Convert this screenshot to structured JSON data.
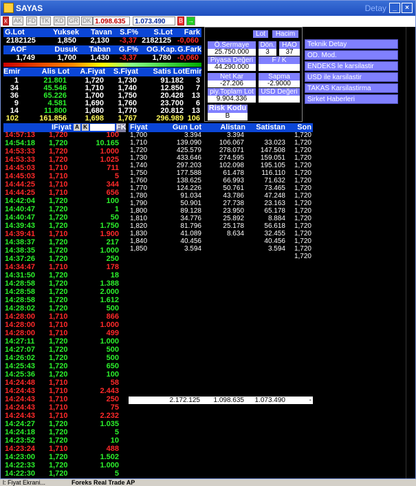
{
  "window": {
    "title": "SAYAS",
    "detay": "Detay"
  },
  "toolbar": {
    "tabs": [
      "AK",
      "FD",
      "TK",
      "KD",
      "GR",
      "DK"
    ],
    "field1": "1.098.635",
    "field2": "1.073.490",
    "b_label": "B"
  },
  "summary": {
    "h1": [
      "G.Lot",
      "Yuksek",
      "Tavan",
      "S.F%",
      "S.Lot",
      "Fark"
    ],
    "v1": [
      "2182125",
      "1,850",
      "2,130",
      "-3,37",
      "2182125",
      "-0,060"
    ],
    "h2": [
      "AOF",
      "Dusuk",
      "Taban",
      "G.F%",
      "OG.Kap.",
      "G.Fark"
    ],
    "v2": [
      "1,749",
      "1,700",
      "1,430",
      "-3,37",
      "1,780",
      "-0,060"
    ]
  },
  "book": {
    "headers": [
      "Emir",
      "Alis Lot",
      "A.Fiyat",
      "S.Fiyat",
      "Satis Lot",
      "Emir"
    ],
    "rows": [
      [
        "1",
        "21.801",
        "1,720",
        "1,730",
        "91.182",
        "3"
      ],
      [
        "34",
        "45.546",
        "1,710",
        "1,740",
        "12.850",
        "7"
      ],
      [
        "36",
        "65.226",
        "1,700",
        "1,750",
        "20.428",
        "13"
      ],
      [
        "9",
        "4.581",
        "1,690",
        "1,760",
        "23.700",
        "6"
      ],
      [
        "14",
        "11.800",
        "1,680",
        "1,770",
        "20.812",
        "13"
      ]
    ],
    "totals": [
      "102",
      "161.856",
      "1,698",
      "1,767",
      "296.989",
      "106"
    ]
  },
  "panel": {
    "tabs": [
      "Lot",
      "Hacim"
    ],
    "osermaye_l": "Ö.Sermaye",
    "osermaye_v": "25.750.000",
    "don_l": "Dön.",
    "don_v": "3",
    "hao_l": "HAO",
    "hao_v": "37",
    "pd_l": "Piyasa Değeri",
    "pd_v": "44.290.000",
    "fk_l": "F / K",
    "fk_v": "",
    "nk_l": "Net Kar",
    "nk_v": "-27.206",
    "sapma_l": "Sapma",
    "sapma_v": "-2.9000",
    "ptl_l": "piy.Toplam Lot",
    "ptl_v": "9.904.336",
    "usd_l": "USD Değeri",
    "usd_v": "",
    "risk_l": "Risk Kodu",
    "risk_v": "B"
  },
  "right_buttons": [
    "Teknik Detay",
    "OD. Mod.",
    "ENDEKS le karsilastir",
    "USD ile karsilastir",
    "TAKAS Karsilastirma",
    "Sirket Haberleri"
  ],
  "trades_header": {
    "price": "IFiyat",
    "a": "A",
    "k": "K",
    "fk": "FK"
  },
  "trades": [
    [
      "14:57:13",
      "1,720",
      "100",
      "r"
    ],
    [
      "14:54:18",
      "1,720",
      "10.165",
      "g"
    ],
    [
      "14:53:33",
      "1,720",
      "1.000",
      "r"
    ],
    [
      "14:53:33",
      "1,720",
      "1.025",
      "r"
    ],
    [
      "14:45:03",
      "1,710",
      "711",
      "r"
    ],
    [
      "14:45:03",
      "1,710",
      "5",
      "r"
    ],
    [
      "14:44:25",
      "1,710",
      "344",
      "r"
    ],
    [
      "14:44:25",
      "1,710",
      "656",
      "r"
    ],
    [
      "14:42:04",
      "1,720",
      "100",
      "g"
    ],
    [
      "14:40:47",
      "1,720",
      "1",
      "g"
    ],
    [
      "14:40:47",
      "1,720",
      "50",
      "g"
    ],
    [
      "14:39:43",
      "1,720",
      "1.750",
      "g"
    ],
    [
      "14:39:41",
      "1,710",
      "1.900",
      "r"
    ],
    [
      "14:38:37",
      "1,720",
      "217",
      "g"
    ],
    [
      "14:38:35",
      "1,720",
      "1.000",
      "g"
    ],
    [
      "14:37:26",
      "1,720",
      "250",
      "g"
    ],
    [
      "14:34:47",
      "1,710",
      "178",
      "r"
    ],
    [
      "14:31:50",
      "1,720",
      "18",
      "g"
    ],
    [
      "14:28:58",
      "1,720",
      "1.388",
      "g"
    ],
    [
      "14:28:58",
      "1,720",
      "2.000",
      "g"
    ],
    [
      "14:28:58",
      "1,720",
      "1.612",
      "g"
    ],
    [
      "14:28:02",
      "1,720",
      "500",
      "g"
    ],
    [
      "14:28:00",
      "1,710",
      "866",
      "r"
    ],
    [
      "14:28:00",
      "1,710",
      "1.000",
      "r"
    ],
    [
      "14:28:00",
      "1,710",
      "499",
      "r"
    ],
    [
      "14:27:11",
      "1,720",
      "1.000",
      "g"
    ],
    [
      "14:27:07",
      "1,720",
      "500",
      "g"
    ],
    [
      "14:26:02",
      "1,720",
      "500",
      "g"
    ],
    [
      "14:25:43",
      "1,720",
      "650",
      "g"
    ],
    [
      "14:25:36",
      "1,720",
      "100",
      "g"
    ],
    [
      "14:24:48",
      "1,710",
      "58",
      "r"
    ],
    [
      "14:24:43",
      "1,710",
      "2.443",
      "r"
    ],
    [
      "14:24:43",
      "1,710",
      "250",
      "r"
    ],
    [
      "14:24:43",
      "1,710",
      "75",
      "r"
    ],
    [
      "14:24:43",
      "1,710",
      "2.232",
      "r"
    ],
    [
      "14:24:27",
      "1,720",
      "1.035",
      "g"
    ],
    [
      "14:24:18",
      "1,720",
      "5",
      "g"
    ],
    [
      "14:23:52",
      "1,720",
      "10",
      "g"
    ],
    [
      "14:23:24",
      "1,710",
      "488",
      "r"
    ],
    [
      "14:23:00",
      "1,720",
      "1.502",
      "g"
    ],
    [
      "14:22:33",
      "1,720",
      "1.000",
      "g"
    ],
    [
      "14:22:30",
      "1,720",
      "5",
      "g"
    ]
  ],
  "depth_headers": [
    "Fiyat",
    "Gun Lot",
    "Alistan",
    "Satistan",
    "Son"
  ],
  "depth": [
    [
      "1,700",
      "3.394",
      "3.394",
      "",
      "1,720"
    ],
    [
      "1,710",
      "139.090",
      "106.067",
      "33.023",
      "1,720"
    ],
    [
      "1,720",
      "425.579",
      "278.071",
      "147.508",
      "1,720"
    ],
    [
      "1,730",
      "433.646",
      "274.595",
      "159.051",
      "1,720"
    ],
    [
      "1,740",
      "297.203",
      "102.098",
      "195.105",
      "1,720"
    ],
    [
      "1,750",
      "177.588",
      "61.478",
      "116.110",
      "1,720"
    ],
    [
      "1,760",
      "138.625",
      "66.993",
      "71.632",
      "1,720"
    ],
    [
      "1,770",
      "124.226",
      "50.761",
      "73.465",
      "1,720"
    ],
    [
      "1,780",
      "91.034",
      "43.786",
      "47.248",
      "1,720"
    ],
    [
      "1,790",
      "50.901",
      "27.738",
      "23.163",
      "1,720"
    ],
    [
      "1,800",
      "89.128",
      "23.950",
      "65.178",
      "1,720"
    ],
    [
      "1,810",
      "34.776",
      "25.892",
      "8.884",
      "1,720"
    ],
    [
      "1,820",
      "81.796",
      "25.178",
      "56.618",
      "1,720"
    ],
    [
      "1,830",
      "41.089",
      "8.634",
      "32.455",
      "1,720"
    ],
    [
      "1,840",
      "40.456",
      "",
      "40.456",
      "1,720"
    ],
    [
      "1,850",
      "3.594",
      "",
      "3.594",
      "1,720"
    ],
    [
      "",
      "",
      "",
      "",
      "1,720"
    ]
  ],
  "depth_totals": [
    "2.172.125",
    "1.098.635",
    "1.073.490",
    "-"
  ],
  "taskbar": {
    "item1": "l: Fiyat Ekrani...",
    "item2": "Foreks Real Trade AP"
  }
}
